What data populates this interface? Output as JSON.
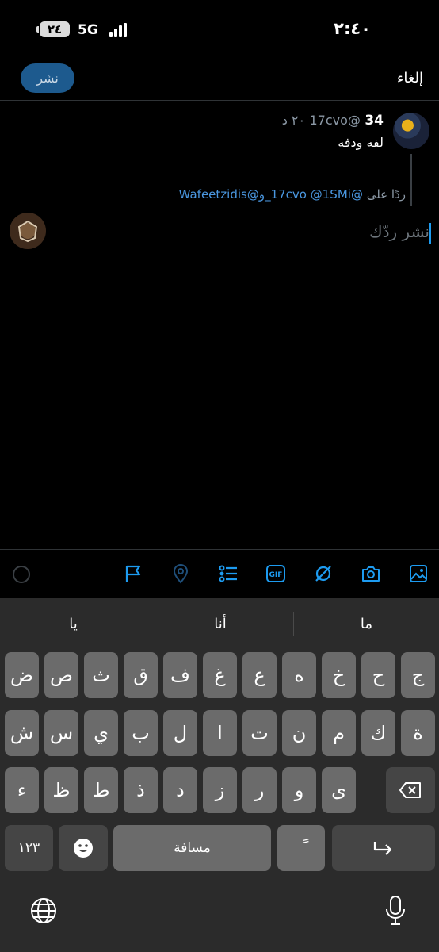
{
  "status": {
    "time": "٢:٤٠",
    "battery": "٢٤",
    "network": "5G"
  },
  "header": {
    "post_label": "نشر",
    "cancel_label": "إلغاء"
  },
  "tweet": {
    "name": "34",
    "handle": "@17cvo",
    "time": "٢٠ د",
    "text": "لفه ودفه"
  },
  "reply": {
    "prefix": "ردًا على",
    "mention1": "@17cvo",
    "mention2": "@1SMi_",
    "conj": "و",
    "mention3": "@Wafeetzidis",
    "placeholder": "نشر ردّك"
  },
  "toolbar": {
    "icons": [
      "progress-ring-icon",
      "flag-icon",
      "location-pin-icon",
      "poll-list-icon",
      "gif-icon",
      "grok-icon",
      "camera-icon",
      "image-icon"
    ],
    "accent": "#1d9bf0"
  },
  "keyboard": {
    "suggestions": [
      "يا",
      "أنا",
      "ما"
    ],
    "row1": [
      "ض",
      "ص",
      "ث",
      "ق",
      "ف",
      "غ",
      "ع",
      "ه",
      "خ",
      "ح",
      "ج"
    ],
    "row2": [
      "ش",
      "س",
      "ي",
      "ب",
      "ل",
      "ا",
      "ت",
      "ن",
      "م",
      "ك",
      "ة"
    ],
    "row3": [
      "ء",
      "ظ",
      "ط",
      "ذ",
      "د",
      "ز",
      "ر",
      "و",
      "ى"
    ],
    "numbers_label": "١٢٣",
    "space_label": "مسافة",
    "diacritic_label": "ً",
    "icons": [
      "emoji-icon",
      "backspace-icon",
      "return-icon",
      "globe-icon",
      "mic-icon"
    ]
  }
}
